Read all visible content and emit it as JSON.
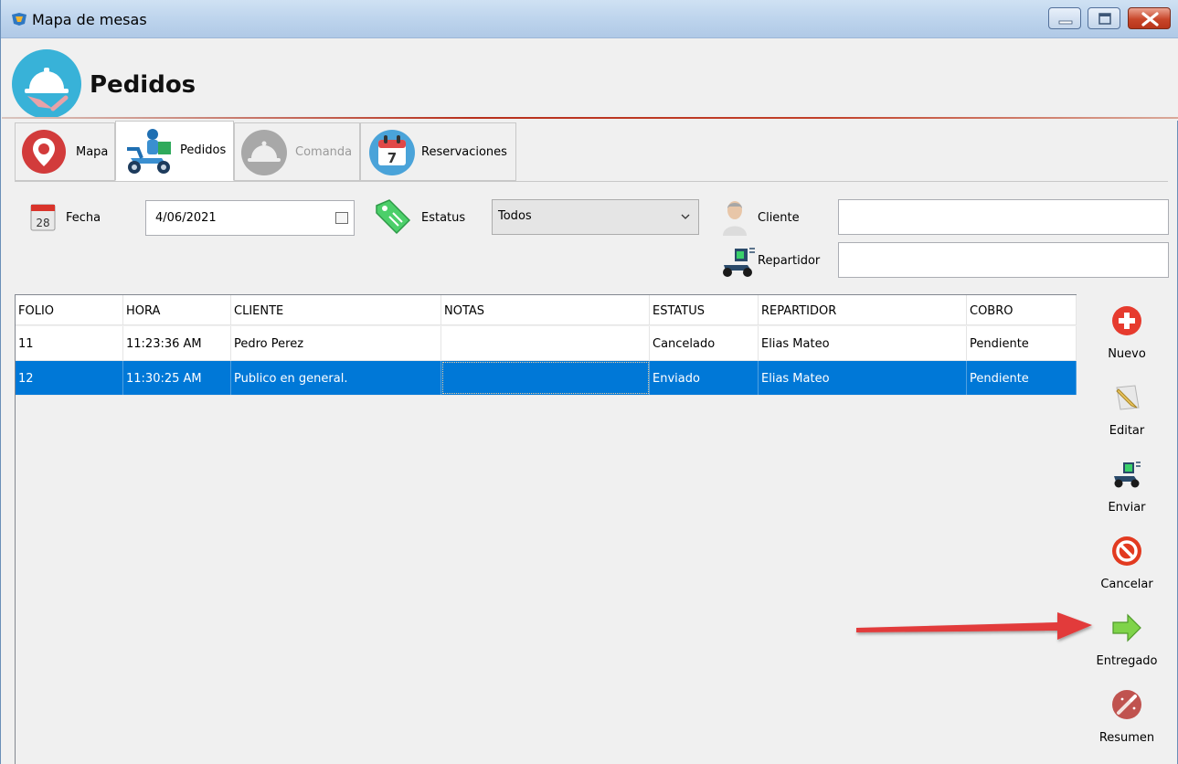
{
  "window": {
    "title": "Mapa de mesas"
  },
  "header": {
    "title": "Pedidos"
  },
  "tabs": [
    {
      "label": "Mapa",
      "icon": "map-pin-icon",
      "state": "normal"
    },
    {
      "label": "Pedidos",
      "icon": "delivery-scooter-icon",
      "state": "active"
    },
    {
      "label": "Comanda",
      "icon": "cloche-icon",
      "state": "disabled"
    },
    {
      "label": "Reservaciones",
      "icon": "calendar-icon",
      "state": "normal"
    }
  ],
  "filters": {
    "fecha": {
      "label": "Fecha",
      "value": "4/06/2021",
      "icon": "calendar-page-icon"
    },
    "estatus": {
      "label": "Estatus",
      "value": "Todos",
      "icon": "tag-icon"
    },
    "cliente": {
      "label": "Cliente",
      "value": "",
      "icon": "person-icon"
    },
    "repartidor": {
      "label": "Repartidor",
      "value": "",
      "icon": "delivery-scooter-icon"
    }
  },
  "table": {
    "columns": [
      "FOLIO",
      "HORA",
      "CLIENTE",
      "NOTAS",
      "ESTATUS",
      "REPARTIDOR",
      "COBRO"
    ],
    "rows": [
      {
        "folio": "11",
        "hora": "11:23:36 AM",
        "cliente": "Pedro Perez",
        "notas": "",
        "estatus": "Cancelado",
        "repartidor": "Elias Mateo",
        "cobro": "Pendiente",
        "selected": false
      },
      {
        "folio": "12",
        "hora": "11:30:25 AM",
        "cliente": "Publico en general.",
        "notas": "",
        "estatus": "Enviado",
        "repartidor": "Elias Mateo",
        "cobro": "Pendiente",
        "selected": true
      }
    ]
  },
  "actions": [
    {
      "label": "Nuevo",
      "icon": "plus-circle-icon"
    },
    {
      "label": "Editar",
      "icon": "pencil-icon"
    },
    {
      "label": "Enviar",
      "icon": "delivery-scooter-icon"
    },
    {
      "label": "Cancelar",
      "icon": "no-entry-icon"
    },
    {
      "label": "Entregado",
      "icon": "right-arrow-icon"
    },
    {
      "label": "Resumen",
      "icon": "magic-wand-icon"
    }
  ],
  "colors": {
    "selection": "#0078d7",
    "accent_red": "#e63b2e",
    "header_rule": "#b8301c",
    "titlebar": "#bcd3ec"
  }
}
